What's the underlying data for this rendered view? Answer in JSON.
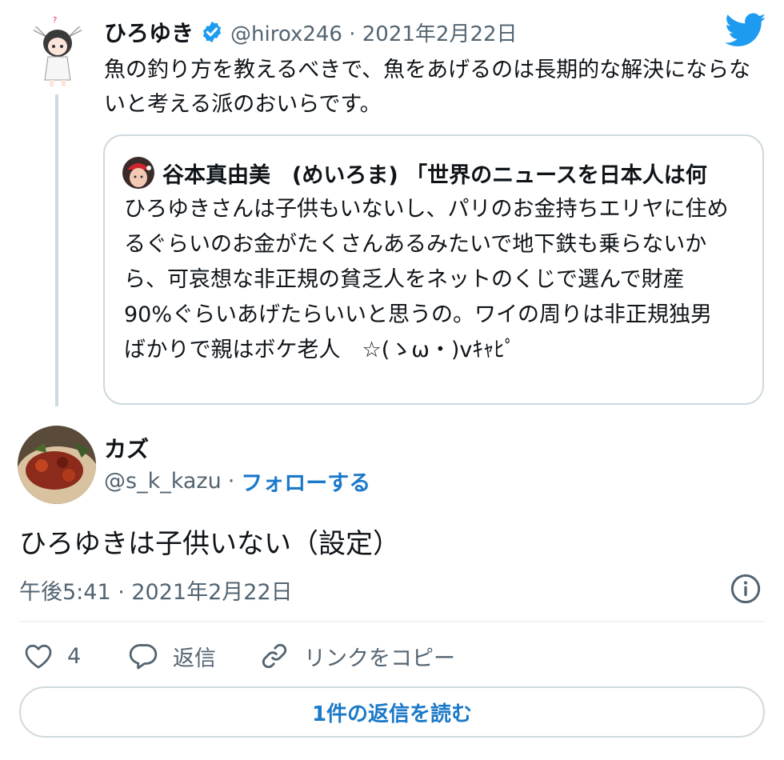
{
  "parent_tweet": {
    "author_name": "ひろゆき",
    "handle_date": "@hirox246 · 2021年2月22日",
    "text": "魚の釣り方を教えるべきで、魚をあげるのは長期的な解決にならないと考える派のおいらです。",
    "avatar_icon": "anime-character-avatar",
    "verified_icon": "verified-badge-icon",
    "brand_icon": "twitter-bird-icon"
  },
  "quote_tweet": {
    "author_name": "谷本真由美　(めいろま) 「世界のニュースを日本人は何",
    "text": "ひろゆきさんは子供もいないし、パリのお金持ちエリヤに住めるぐらいのお金がたくさんあるみたいで地下鉄も乗らないから、可哀想な非正規の貧乏人をネットのくじで選んで財産90%ぐらいあげたらいいと思うの。ワイの周りは非正規独男ばかりで親はボケ老人　☆(ゝω・)vｷｬﾋﾟ"
  },
  "reply_tweet": {
    "author_name": "カズ",
    "handle": "@s_k_kazu",
    "separator": "·",
    "follow_label": "フォローする",
    "text": "ひろゆきは子供いない（設定）",
    "timestamp": "午後5:41 · 2021年2月22日"
  },
  "actions": {
    "like_count": "4",
    "reply_label": "返信",
    "copy_link_label": "リンクをコピー"
  },
  "read_replies_label": "1件の返信を読む",
  "colors": {
    "accent": "#1b79c9",
    "twitter_blue": "#1d9bf0",
    "secondary_text": "#536471",
    "border": "#cfd9de"
  }
}
